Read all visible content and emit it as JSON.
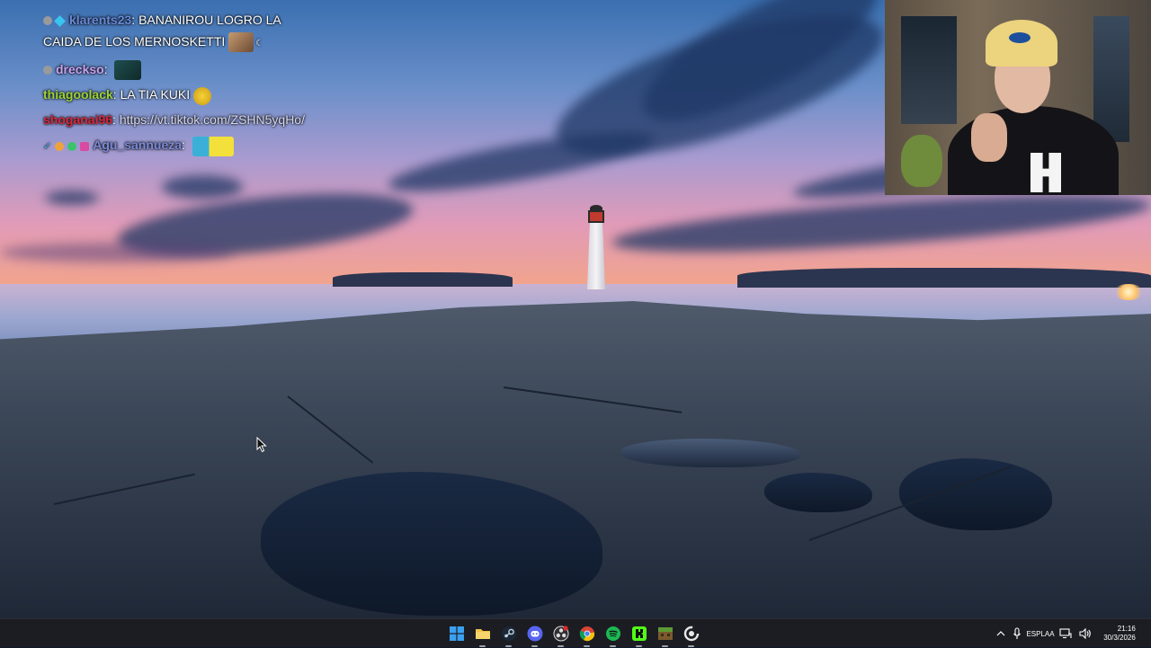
{
  "chat": {
    "messages": [
      {
        "name": "klarents23",
        "name_color": "#6a8ad8",
        "separator": ": ",
        "text": "BANANIROU LOGRO LA CAIDA DE LOS MERNOSKETTI",
        "badges": [
          "gray-dot-badge",
          "diamond-badge"
        ]
      },
      {
        "name": "drecksо",
        "name_color": "#c9a2f2",
        "separator": ": ",
        "text": "",
        "badges": [
          "gray-dot-badge"
        ]
      },
      {
        "name": "thiagoolack",
        "name_color": "#9bd33a",
        "separator": ": ",
        "text": "LA TIA KUKI",
        "badges": []
      },
      {
        "name": "shoganai96",
        "name_color": "#d9283c",
        "separator": ": ",
        "text": "https://vt.tiktok.com/ZSHN5yqHo/",
        "badges": []
      },
      {
        "name": "Agu_sannueza",
        "name_color": "#7a8ad8",
        "separator": ": ",
        "text": "",
        "badges": [
          "check-badge",
          "smiley-badge",
          "green-badge",
          "gift-badge"
        ]
      }
    ]
  },
  "taskbar": {
    "apps": [
      {
        "name": "windows-start",
        "icon": "windows-logo-icon",
        "color": "#3aa0f0"
      },
      {
        "name": "file-explorer",
        "icon": "folder-icon",
        "color": "#f2c14a"
      },
      {
        "name": "steam",
        "icon": "steam-icon",
        "color": "#2b3a52"
      },
      {
        "name": "discord",
        "icon": "discord-icon",
        "color": "#5865f2"
      },
      {
        "name": "obs",
        "icon": "obs-icon",
        "color": "#3a3a3a"
      },
      {
        "name": "chrome",
        "icon": "chrome-icon",
        "color": "#e0c23a"
      },
      {
        "name": "spotify",
        "icon": "spotify-icon",
        "color": "#1db954"
      },
      {
        "name": "kick",
        "icon": "kick-icon",
        "color": "#53fc18"
      },
      {
        "name": "minecraft",
        "icon": "minecraft-icon",
        "color": "#8a6a3a"
      },
      {
        "name": "ccleaner",
        "icon": "ccleaner-icon",
        "color": "#3a3a3a"
      }
    ],
    "tray": {
      "language_line1": "ESP",
      "language_line2": "LAA",
      "time": "21:16",
      "date": "30/3/2026"
    }
  }
}
